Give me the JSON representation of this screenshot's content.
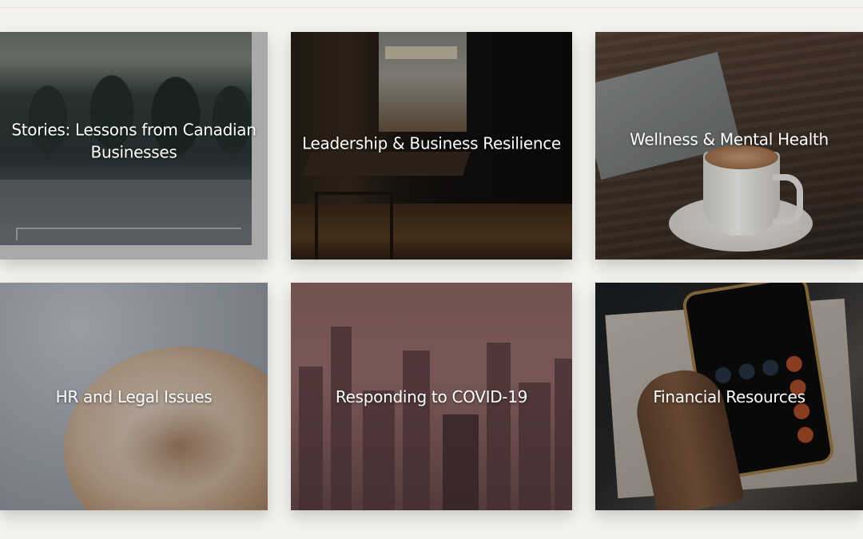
{
  "tiles": [
    {
      "title": "Stories: Lessons from Canadian Businesses"
    },
    {
      "title": "Leadership & Business Resilience"
    },
    {
      "title": "Wellness & Mental Health"
    },
    {
      "title": "HR and Legal Issues"
    },
    {
      "title": "Responding to COVID-19"
    },
    {
      "title": "Financial Resources"
    }
  ]
}
